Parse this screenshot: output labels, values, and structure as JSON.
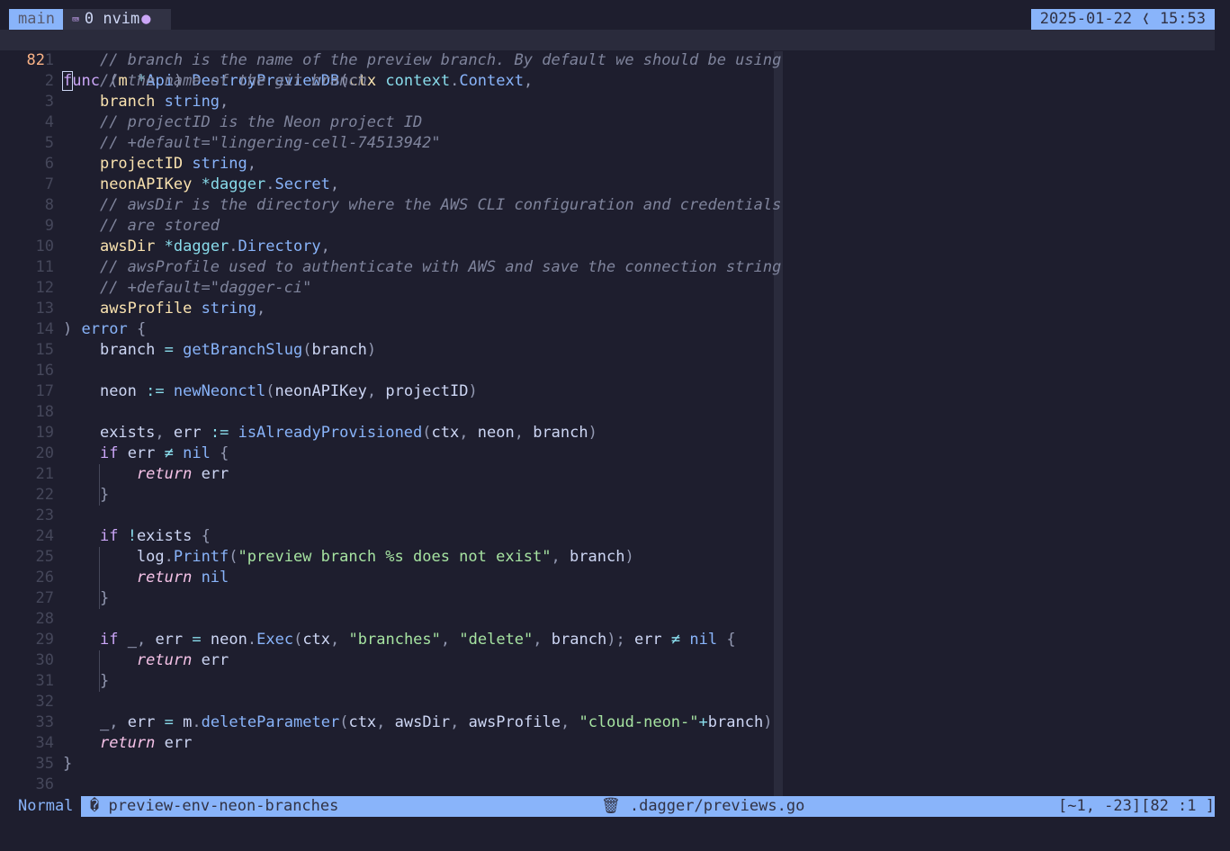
{
  "tmux": {
    "session": "main",
    "window_index": "0",
    "window_name": "nvim",
    "window_icon": "terminal-icon",
    "modified_marker": "●",
    "datetime": "2025-01-22 ❬ 15:53"
  },
  "editor": {
    "current_line_number": "82",
    "signature_func_kw": "func",
    "signature_rest": "func (m *Api) DestroyPreviewDB(ctx context.Context,",
    "lines": [
      {
        "n": "1",
        "text": "    // branch is the name of the preview branch. By default we should be using"
      },
      {
        "n": "2",
        "text": "    // the name of the git branch"
      },
      {
        "n": "3",
        "text": "    branch string,"
      },
      {
        "n": "4",
        "text": "    // projectID is the Neon project ID"
      },
      {
        "n": "5",
        "text": "    // +default=\"lingering-cell-74513942\""
      },
      {
        "n": "6",
        "text": "    projectID string,"
      },
      {
        "n": "7",
        "text": "    neonAPIKey *dagger.Secret,"
      },
      {
        "n": "8",
        "text": "    // awsDir is the directory where the AWS CLI configuration and credentials"
      },
      {
        "n": "9",
        "text": "    // are stored"
      },
      {
        "n": "10",
        "text": "    awsDir *dagger.Directory,"
      },
      {
        "n": "11",
        "text": "    // awsProfile used to authenticate with AWS and save the connection string"
      },
      {
        "n": "12",
        "text": "    // +default=\"dagger-ci\""
      },
      {
        "n": "13",
        "text": "    awsProfile string,"
      },
      {
        "n": "14",
        "text": ") error {"
      },
      {
        "n": "15",
        "text": "    branch = getBranchSlug(branch)"
      },
      {
        "n": "16",
        "text": ""
      },
      {
        "n": "17",
        "text": "    neon := newNeonctl(neonAPIKey, projectID)"
      },
      {
        "n": "18",
        "text": ""
      },
      {
        "n": "19",
        "text": "    exists, err := isAlreadyProvisioned(ctx, neon, branch)"
      },
      {
        "n": "20",
        "text": "    if err ≠ nil {"
      },
      {
        "n": "21",
        "text": "        return err"
      },
      {
        "n": "22",
        "text": "    }"
      },
      {
        "n": "23",
        "text": ""
      },
      {
        "n": "24",
        "text": "    if !exists {"
      },
      {
        "n": "25",
        "text": "        log.Printf(\"preview branch %s does not exist\", branch)"
      },
      {
        "n": "26",
        "text": "        return nil"
      },
      {
        "n": "27",
        "text": "    }"
      },
      {
        "n": "28",
        "text": ""
      },
      {
        "n": "29",
        "text": "    if _, err = neon.Exec(ctx, \"branches\", \"delete\", branch); err ≠ nil {"
      },
      {
        "n": "30",
        "text": "        return err"
      },
      {
        "n": "31",
        "text": "    }"
      },
      {
        "n": "32",
        "text": ""
      },
      {
        "n": "33",
        "text": "    _, err = m.deleteParameter(ctx, awsDir, awsProfile, \"cloud-neon-\"+branch)"
      },
      {
        "n": "34",
        "text": "    return err"
      },
      {
        "n": "35",
        "text": "}"
      },
      {
        "n": "36",
        "text": ""
      }
    ]
  },
  "statusline": {
    "mode": "Normal",
    "git_icon": "git-branch-icon",
    "branch": "preview-env-neon-branches",
    "file_icon": "trash-icon",
    "filename": ".dagger/previews.go",
    "position": "[~1, -23][82 :1 ]"
  },
  "colors": {
    "background": "#1e1e2e",
    "accent": "#89b4fa",
    "line_number_current": "#fab387",
    "comment": "#7f849c",
    "string": "#a6e3a1",
    "keyword": "#cba6f7"
  }
}
